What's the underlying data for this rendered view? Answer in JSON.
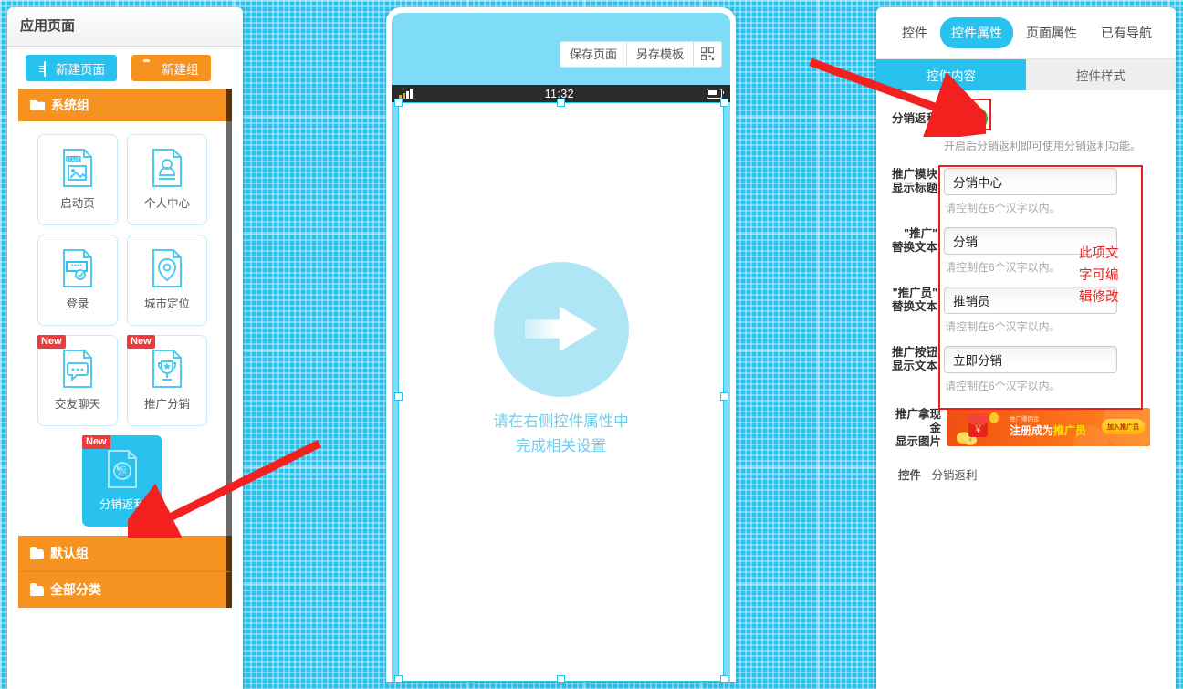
{
  "left_panel": {
    "title": "应用页面",
    "buttons": [
      {
        "label": "新建页面",
        "icon": "document-icon",
        "color": "#29c2ef"
      },
      {
        "label": "新建组",
        "icon": "folder-icon",
        "color": "#f59220"
      }
    ],
    "groups": {
      "system": "系统组",
      "default": "默认组",
      "all": "全部分类"
    },
    "pages": [
      {
        "label": "启动页",
        "icon": "start-page-icon",
        "badge": "",
        "active": false
      },
      {
        "label": "个人中心",
        "icon": "user-profile-icon",
        "badge": "",
        "active": false
      },
      {
        "label": "登录",
        "icon": "login-password-icon",
        "badge": "",
        "active": false
      },
      {
        "label": "城市定位",
        "icon": "location-pin-icon",
        "badge": "",
        "active": false
      },
      {
        "label": "交友聊天",
        "icon": "chat-bubble-icon",
        "badge": "New",
        "active": false
      },
      {
        "label": "推广分销",
        "icon": "trophy-icon",
        "badge": "New",
        "active": false
      },
      {
        "label": "分销返利",
        "icon": "rebate-return-icon",
        "badge": "New",
        "active": true
      }
    ]
  },
  "phone": {
    "toolbar": [
      {
        "label": "保存页面",
        "name": "save-page-button"
      },
      {
        "label": "另存模板",
        "name": "save-as-template-button"
      },
      {
        "label": "",
        "name": "qr-code-button",
        "icon": "qr-code-icon"
      }
    ],
    "status_bar": {
      "time": "11:32",
      "signal_icon": "signal-bars-icon",
      "battery_icon": "battery-icon"
    },
    "placeholder": {
      "icon": "arrow-right-circle-icon",
      "line1": "请在右侧控件属性中",
      "line2": "完成相关设置"
    }
  },
  "right_panel": {
    "tabs": [
      {
        "label": "控件",
        "selected": false
      },
      {
        "label": "控件属性",
        "selected": true
      },
      {
        "label": "页面属性",
        "selected": false
      },
      {
        "label": "已有导航",
        "selected": false
      }
    ],
    "subtabs": [
      {
        "label": "控件内容",
        "selected": true
      },
      {
        "label": "控件样式",
        "selected": false
      }
    ],
    "toggle_row": {
      "label": "分销返利",
      "state": "on",
      "hint": "开启后分销返利即可使用分销返利功能。",
      "on_color": "#4bbf3d"
    },
    "fields": [
      {
        "label_line1": "推广模块",
        "label_line2": "显示标题",
        "value": "分销中心",
        "hint": "请控制在6个汉字以内。"
      },
      {
        "label_line1": "\"推广\"",
        "label_line2": "替换文本",
        "value": "分销",
        "hint": "请控制在6个汉字以内。"
      },
      {
        "label_line1": "\"推广员\"",
        "label_line2": "替换文本",
        "value": "推销员",
        "hint": "请控制在6个汉字以内。"
      },
      {
        "label_line1": "推广按钮",
        "label_line2": "显示文本",
        "value": "立即分销",
        "hint": "请控制在6个汉字以内。"
      }
    ],
    "image_row": {
      "label_line1": "推广拿现金",
      "label_line2": "显示图片",
      "banner_small_text": "推广赚佣金",
      "banner_main_text_1": "注册成为",
      "banner_main_text_2": "推广员",
      "banner_button": "加入推广员"
    },
    "footer": {
      "label": "控件",
      "value": "分销返利"
    }
  },
  "annotations": {
    "note_text": "此项文字可编辑修改",
    "note_lines": [
      "此项文",
      "字可编",
      "辑修改"
    ],
    "highlight_color": "#ee1c1c",
    "arrow_color": "#f02020"
  }
}
